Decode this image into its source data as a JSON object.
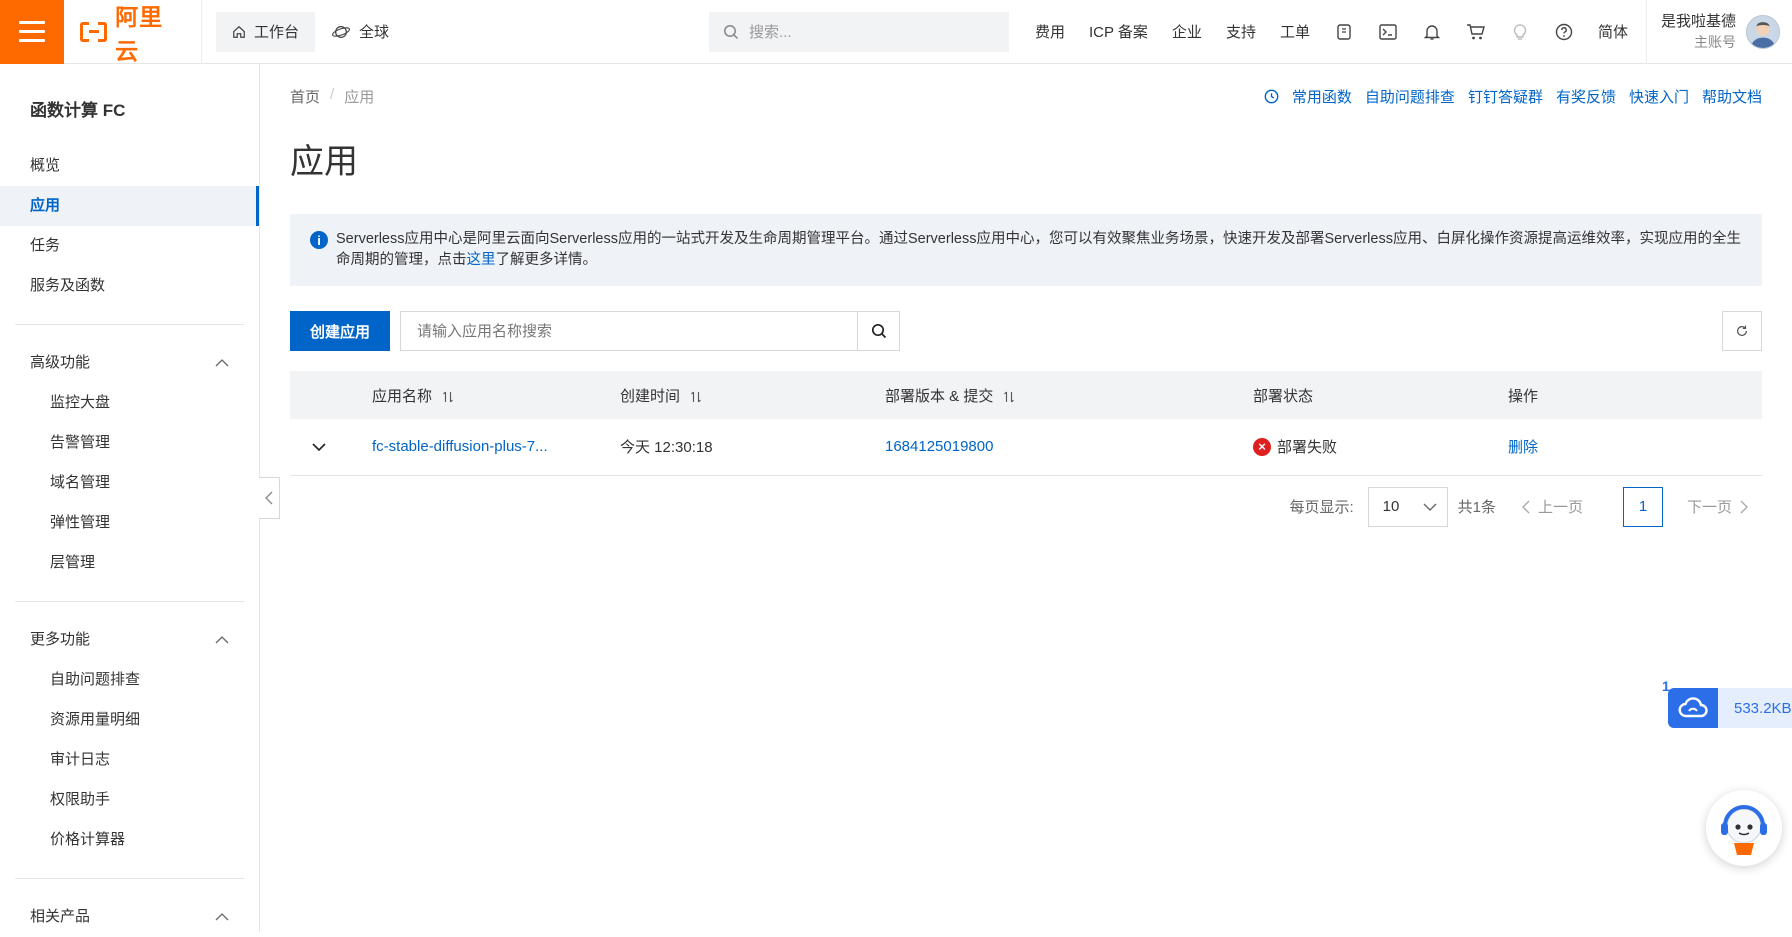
{
  "topbar": {
    "logo_text": "阿里云",
    "workbench_label": "工作台",
    "global_label": "全球",
    "search_placeholder": "搜索...",
    "links": [
      "费用",
      "ICP 备案",
      "企业",
      "支持",
      "工单"
    ],
    "lang_label": "简体",
    "user_name": "是我啦基德",
    "user_role": "主账号",
    "accent_color": "#ff6a00"
  },
  "sidebar": {
    "title": "函数计算 FC",
    "items": [
      {
        "label": "概览"
      },
      {
        "label": "应用"
      },
      {
        "label": "任务"
      },
      {
        "label": "服务及函数"
      }
    ],
    "groups": [
      {
        "label": "高级功能",
        "items": [
          "监控大盘",
          "告警管理",
          "域名管理",
          "弹性管理",
          "层管理"
        ]
      },
      {
        "label": "更多功能",
        "items": [
          "自助问题排查",
          "资源用量明细",
          "审计日志",
          "权限助手",
          "价格计算器"
        ]
      },
      {
        "label": "相关产品",
        "items": []
      }
    ]
  },
  "breadcrumb": {
    "home": "首页",
    "current": "应用"
  },
  "help_links": [
    "常用函数",
    "自助问题排查",
    "钉钉答疑群",
    "有奖反馈",
    "快速入门",
    "帮助文档"
  ],
  "page_title": "应用",
  "notice": {
    "text_before": "Serverless应用中心是阿里云面向Serverless应用的一站式开发及生命周期管理平台。通过Serverless应用中心，您可以有效聚焦业务场景，快速开发及部署Serverless应用、白屏化操作资源提高运维效率，实现应用的全生命周期的管理，点击",
    "link": "这里",
    "text_after": "了解更多详情。"
  },
  "toolbar": {
    "create_label": "创建应用",
    "search_placeholder": "请输入应用名称搜索"
  },
  "table": {
    "columns": [
      "应用名称",
      "创建时间",
      "部署版本 & 提交",
      "部署状态",
      "操作"
    ],
    "rows": [
      {
        "name": "fc-stable-diffusion-plus-7...",
        "created": "今天 12:30:18",
        "version": "1684125019800",
        "status": "部署失败",
        "action": "删除"
      }
    ]
  },
  "pager": {
    "page_size_label": "每页显示:",
    "page_size": "10",
    "total": "共1条",
    "prev": "上一页",
    "current": "1",
    "next": "下一页"
  },
  "download_widget": {
    "badge": "1",
    "size": "533.2KB"
  },
  "colors": {
    "primary": "#0064c8",
    "error": "#e02020",
    "brand": "#ff6a00"
  }
}
